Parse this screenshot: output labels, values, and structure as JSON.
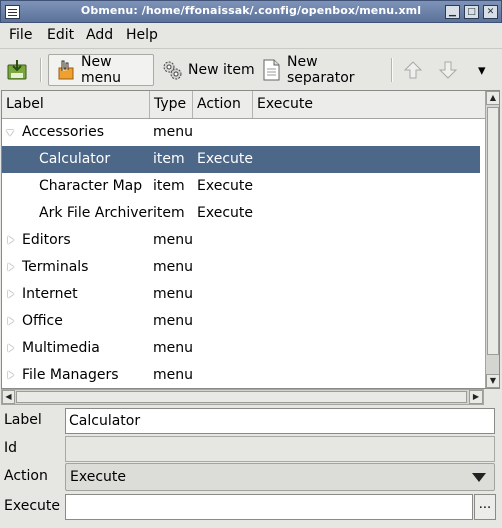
{
  "window": {
    "title": "Obmenu: /home/ffonaissak/.config/openbox/menu.xml",
    "min_glyph": "▁",
    "max_glyph": "□",
    "close_glyph": "✕"
  },
  "menubar": {
    "file": "File",
    "edit": "Edit",
    "add": "Add",
    "help": "Help"
  },
  "toolbar": {
    "new_menu": "New menu",
    "new_item": "New item",
    "new_separator": "New separator",
    "overflow_glyph": "▾"
  },
  "tree": {
    "columns": {
      "label": "Label",
      "type": "Type",
      "action": "Action",
      "execute": "Execute"
    },
    "rows": [
      {
        "label": "Accessories",
        "type": "menu",
        "action": ""
      },
      {
        "label": "Calculator",
        "type": "item",
        "action": "Execute"
      },
      {
        "label": "Character Map",
        "type": "item",
        "action": "Execute"
      },
      {
        "label": "Ark File Archiver",
        "type": "item",
        "action": "Execute"
      },
      {
        "label": "Editors",
        "type": "menu",
        "action": ""
      },
      {
        "label": "Terminals",
        "type": "menu",
        "action": ""
      },
      {
        "label": "Internet",
        "type": "menu",
        "action": ""
      },
      {
        "label": "Office",
        "type": "menu",
        "action": ""
      },
      {
        "label": "Multimedia",
        "type": "menu",
        "action": ""
      },
      {
        "label": "File Managers",
        "type": "menu",
        "action": ""
      }
    ]
  },
  "form": {
    "label_caption": "Label",
    "label_value": "Calculator",
    "id_caption": "Id",
    "id_value": "",
    "action_caption": "Action",
    "action_value": "Execute",
    "execute_caption": "Execute",
    "execute_value": "",
    "browse_label": "..."
  },
  "colors": {
    "selection": "#4d6789",
    "titlebar": "#5c7299"
  }
}
